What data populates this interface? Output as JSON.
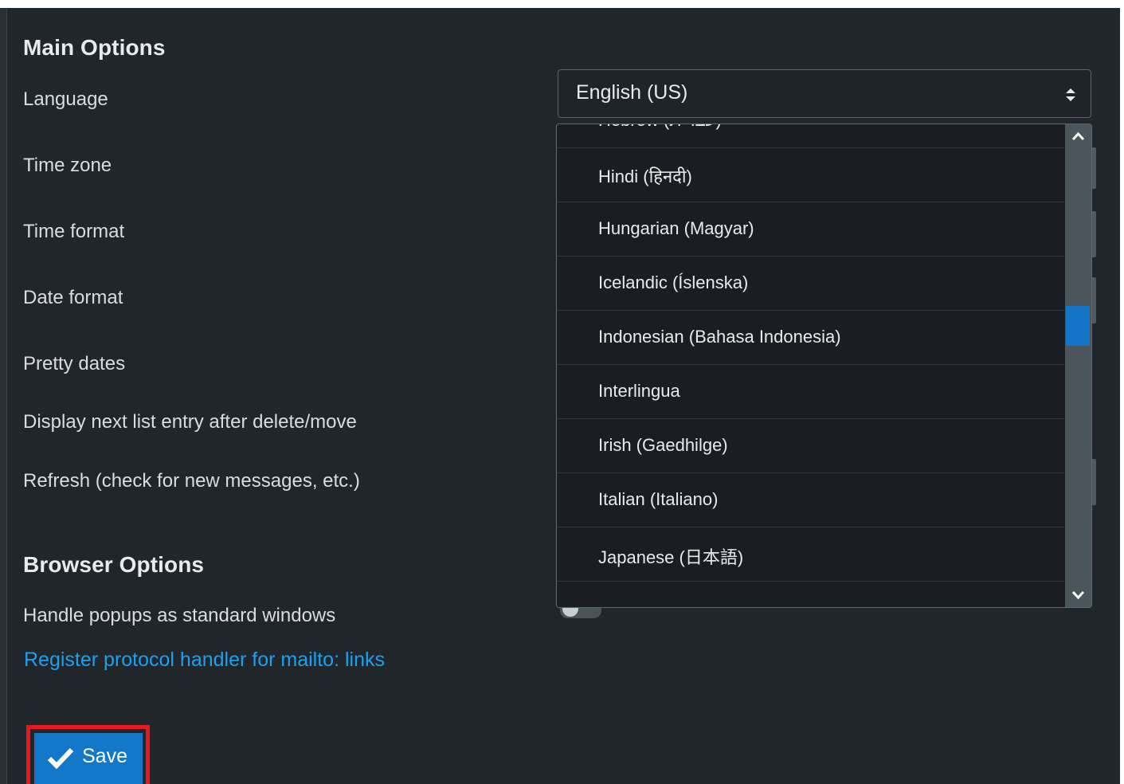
{
  "main_options": {
    "title": "Main Options",
    "labels": {
      "language": "Language",
      "time_zone": "Time zone",
      "time_format": "Time format",
      "date_format": "Date format",
      "pretty_dates": "Pretty dates",
      "next_entry": "Display next list entry after delete/move",
      "refresh": "Refresh (check for new messages, etc.)"
    }
  },
  "language_select": {
    "selected": "English (US)",
    "options": [
      "Hebrew (עברית)",
      "Hindi (हिनदी)",
      "Hungarian (Magyar)",
      "Icelandic (Íslenska)",
      "Indonesian (Bahasa Indonesia)",
      "Interlingua",
      "Irish (Gaedhilge)",
      "Italian (Italiano)",
      "Japanese (日本語)"
    ],
    "scroll_position": 0.4
  },
  "browser_options": {
    "title": "Browser Options",
    "popups_label": "Handle popups as standard windows",
    "protocol_link": "Register protocol handler for mailto: links"
  },
  "actions": {
    "save_label": "Save"
  },
  "colors": {
    "panel_bg": "#21262b",
    "accent": "#1378c8",
    "link": "#1aa1f2",
    "highlight": "#e5191f"
  }
}
